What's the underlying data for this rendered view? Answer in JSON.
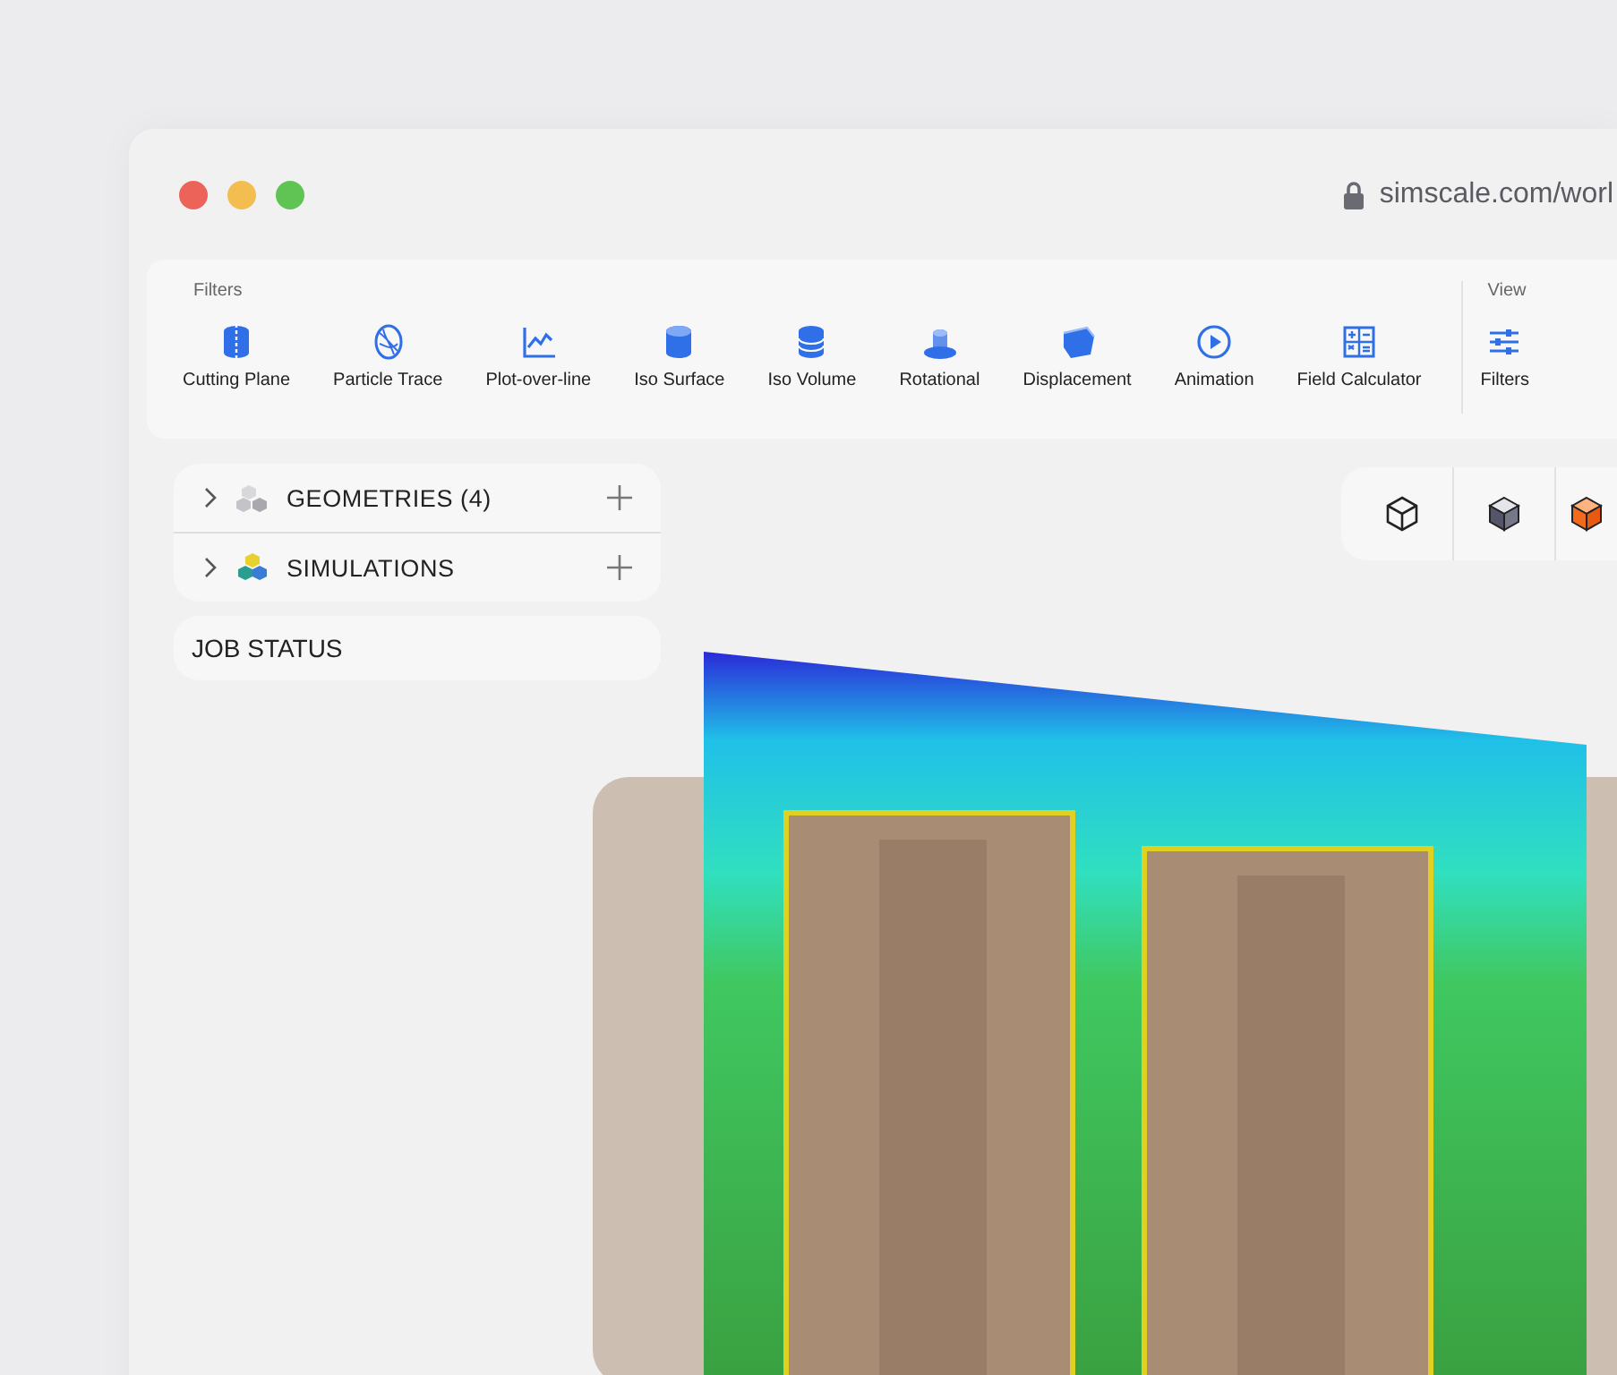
{
  "window": {
    "url": "simscale.com/worl"
  },
  "toolbar": {
    "groups": [
      {
        "title": "Filters",
        "items": [
          {
            "label": "Cutting Plane",
            "kind": "plane"
          },
          {
            "label": "Particle Trace",
            "kind": "trace"
          },
          {
            "label": "Plot-over-line",
            "kind": "plot"
          },
          {
            "label": "Iso Surface",
            "kind": "surface"
          },
          {
            "label": "Iso Volume",
            "kind": "volume"
          },
          {
            "label": "Rotational",
            "kind": "rotational"
          },
          {
            "label": "Displacement",
            "kind": "displacement"
          },
          {
            "label": "Animation",
            "kind": "animation"
          },
          {
            "label": "Field Calculator",
            "kind": "calculator"
          }
        ]
      },
      {
        "title": "View",
        "items": [
          {
            "label": "Filters",
            "kind": "sliders"
          }
        ]
      }
    ]
  },
  "tree": [
    {
      "label": "GEOMETRIES (4)",
      "kind": "geometries",
      "expanded": false
    },
    {
      "label": "SIMULATIONS",
      "kind": "simulations",
      "expanded": false
    }
  ],
  "job_status": {
    "label": "JOB STATUS"
  }
}
